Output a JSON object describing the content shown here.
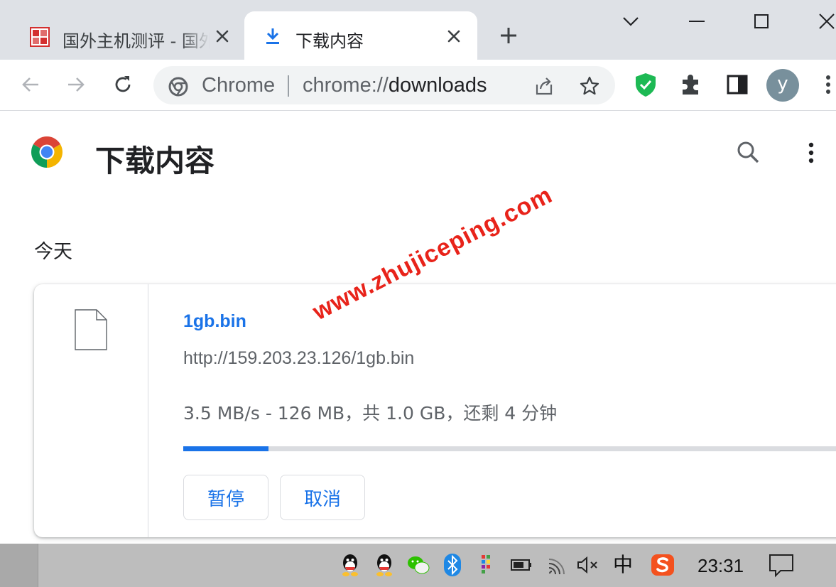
{
  "tabs": [
    {
      "title": "国外主机测评 - 国外",
      "active": false
    },
    {
      "title": "下载内容",
      "active": true
    }
  ],
  "omnibox": {
    "site_label": "Chrome",
    "url_scheme": "chrome://",
    "url_host": "downloads"
  },
  "profile": {
    "initial": "y",
    "color": "#78909c"
  },
  "page": {
    "title": "下载内容",
    "date_group": "今天"
  },
  "download": {
    "file_name": "1gb.bin",
    "url": "http://159.203.23.126/1gb.bin",
    "status": "3.5 MB/s - 126 MB，共 1.0 GB，还剩 4 分钟",
    "progress_fraction": 0.126,
    "pause_label": "暂停",
    "cancel_label": "取消"
  },
  "watermark": "www.zhujiceping.com",
  "taskbar": {
    "clock": "23:31",
    "ime": "中",
    "tray_icons": [
      "qq-icon",
      "qq-icon",
      "wechat-icon",
      "bluetooth-icon",
      "app-grid-icon",
      "battery-icon",
      "wifi-icon",
      "volume-muted-icon",
      "ime-icon",
      "sogou-icon"
    ]
  },
  "colors": {
    "accent": "#1a73e8",
    "tabstrip": "#dee1e6",
    "watermark": "#e8231a",
    "shield": "#1db954"
  }
}
